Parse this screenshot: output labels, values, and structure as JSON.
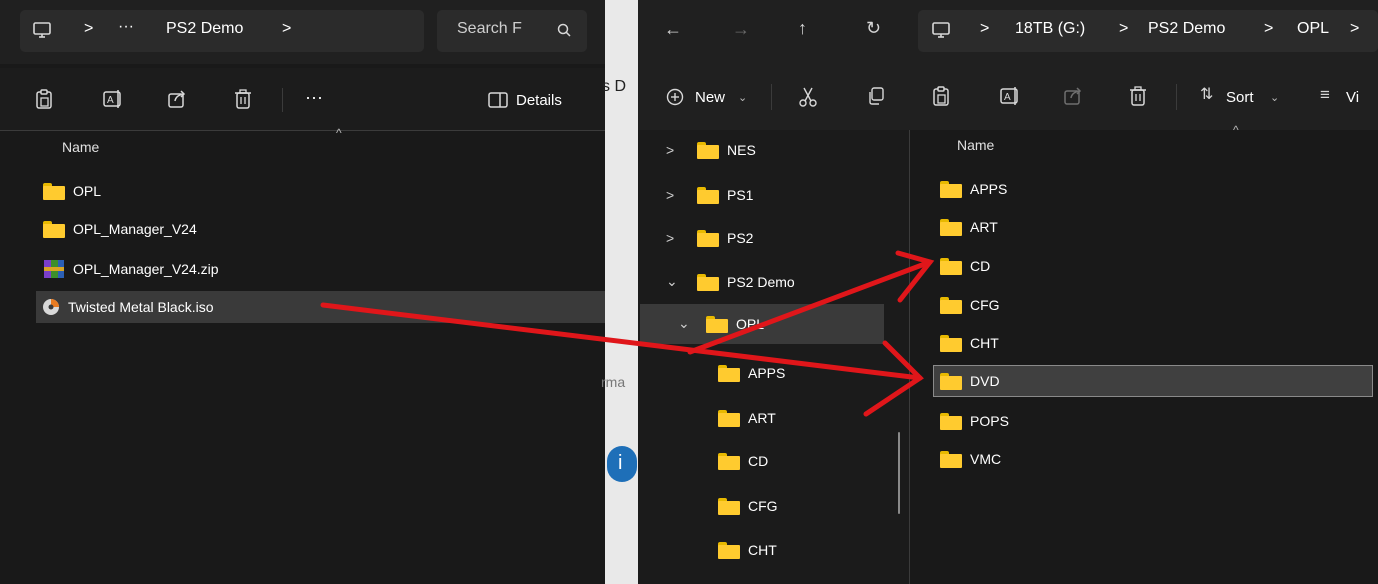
{
  "left_window": {
    "breadcrumb": {
      "more": "···",
      "folder": "PS2 Demo",
      "sep": ">"
    },
    "search": {
      "placeholder": "Search F"
    },
    "toolbar": {
      "more": "···",
      "details": "Details"
    },
    "column_header": "Name",
    "files": [
      {
        "name": "OPL",
        "icon": "folder-icon"
      },
      {
        "name": "OPL_Manager_V24",
        "icon": "folder-icon"
      },
      {
        "name": "OPL_Manager_V24.zip",
        "icon": "zip-archive-icon"
      },
      {
        "name": "Twisted Metal Black.iso",
        "icon": "disc-image-icon"
      }
    ]
  },
  "middle_strip": {
    "fragment_top": "s D",
    "fragment_mid": "rma",
    "info_glyph": "i"
  },
  "right_window": {
    "breadcrumb": {
      "drive": "18TB (G:)",
      "folder1": "PS2 Demo",
      "folder2": "OPL",
      "sep": ">"
    },
    "toolbar": {
      "new_label": "New",
      "sort_label": "Sort",
      "view_label": "Vi"
    },
    "column_header": "Name",
    "nav_tree": [
      {
        "label": "NES",
        "expanded": false
      },
      {
        "label": "PS1",
        "expanded": false
      },
      {
        "label": "PS2",
        "expanded": false
      },
      {
        "label": "PS2 Demo",
        "expanded": true
      },
      {
        "label": "OPL",
        "expanded": true
      },
      {
        "label": "APPS"
      },
      {
        "label": "ART"
      },
      {
        "label": "CD"
      },
      {
        "label": "CFG"
      },
      {
        "label": "CHT"
      }
    ],
    "folders": [
      "APPS",
      "ART",
      "CD",
      "CFG",
      "CHT",
      "DVD",
      "POPS",
      "VMC"
    ],
    "selected_folder": "DVD"
  },
  "annotation": {
    "arrow_color": "#e0161a"
  },
  "colors": {
    "folder": "#ffcb2f",
    "selection": "#404040"
  }
}
